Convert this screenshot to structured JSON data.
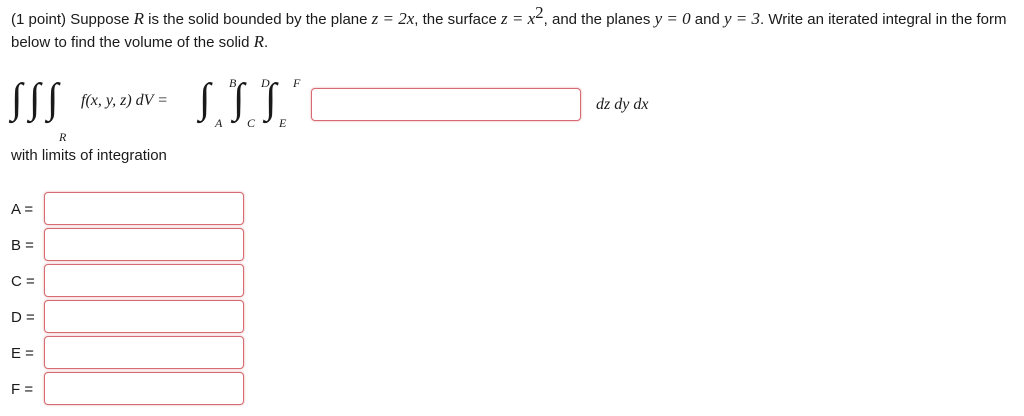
{
  "problem": {
    "t1": "(1 point) Suppose ",
    "R": "R",
    "t2": " is the solid bounded by the plane ",
    "plane": "z = 2x",
    "t3": ", the surface ",
    "surface": "z = x",
    "surface_exp": "2",
    "t4": ", and the planes ",
    "y0": "y = 0",
    "t5": " and ",
    "y3": "y = 3",
    "t6": ". Write an iterated integral in the form below to find the volume of the solid ",
    "R2": "R",
    "t7": "."
  },
  "formula": {
    "lhs_integrand": "f(x, y, z) dV =",
    "region": "R",
    "lim_A": "A",
    "lim_B": "B",
    "lim_C": "C",
    "lim_D": "D",
    "lim_E": "E",
    "lim_F": "F",
    "differentials": "dz dy dx"
  },
  "limits_label": "with limits of integration",
  "rows": [
    {
      "label": "A =",
      "value": ""
    },
    {
      "label": "B =",
      "value": ""
    },
    {
      "label": "C =",
      "value": ""
    },
    {
      "label": "D =",
      "value": ""
    },
    {
      "label": "E =",
      "value": ""
    },
    {
      "label": "F =",
      "value": ""
    }
  ],
  "colors": {
    "input_border": "#d66b73",
    "text": "#1a1a1a"
  }
}
